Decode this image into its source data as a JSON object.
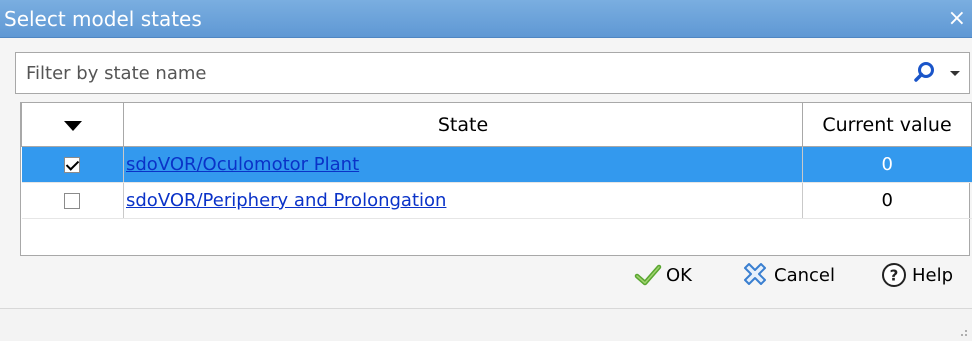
{
  "window": {
    "title": "Select model states",
    "close_glyph": "×"
  },
  "filter": {
    "placeholder": "Filter by state name",
    "value": "",
    "icon": "search-icon"
  },
  "table": {
    "columns": [
      "State",
      "Current value"
    ],
    "rows": [
      {
        "checked": true,
        "state": "sdoVOR/Oculomotor Plant",
        "value": "0",
        "selected": true
      },
      {
        "checked": false,
        "state": "sdoVOR/Periphery and Prolongation",
        "value": "0",
        "selected": false
      }
    ]
  },
  "buttons": {
    "ok": "OK",
    "cancel": "Cancel",
    "help": "Help"
  },
  "colors": {
    "titlebar": "#6aa3da",
    "selection": "#3399ee",
    "link": "#0a32c8"
  }
}
